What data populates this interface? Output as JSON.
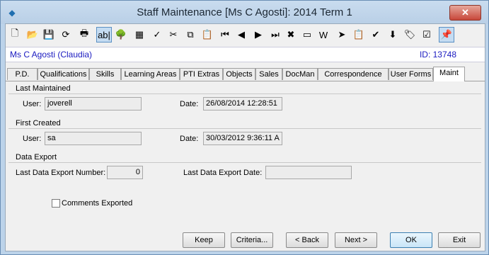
{
  "window": {
    "title": "Staff Maintenance  [Ms C Agosti]:  2014 Term 1",
    "close_label": "✕"
  },
  "toolbar": {
    "icons": [
      {
        "name": "new-icon",
        "glyph": "🗋"
      },
      {
        "name": "open-icon",
        "glyph": "📂"
      },
      {
        "name": "save-icon",
        "glyph": "💾"
      },
      {
        "name": "refresh-icon",
        "glyph": "⟳"
      },
      {
        "name": "print-icon",
        "glyph": "🖶"
      },
      {
        "name": "field-icon",
        "glyph": "ab|"
      },
      {
        "name": "tree-icon",
        "glyph": "🌳"
      },
      {
        "name": "calculator-icon",
        "glyph": "▦"
      },
      {
        "name": "spellcheck-icon",
        "glyph": "✓"
      },
      {
        "name": "cut-icon",
        "glyph": "✂"
      },
      {
        "name": "copy-icon",
        "glyph": "⧉"
      },
      {
        "name": "paste-icon",
        "glyph": "📋"
      },
      {
        "name": "first-record-icon",
        "glyph": "⏮"
      },
      {
        "name": "previous-record-icon",
        "glyph": "◀"
      },
      {
        "name": "next-record-icon",
        "glyph": "▶"
      },
      {
        "name": "last-record-icon",
        "glyph": "⏭"
      },
      {
        "name": "delete-icon",
        "glyph": "✖"
      },
      {
        "name": "card-icon",
        "glyph": "▭"
      },
      {
        "name": "word-icon",
        "glyph": "W"
      },
      {
        "name": "send-icon",
        "glyph": "➤"
      },
      {
        "name": "clipboard-icon",
        "glyph": "📋"
      },
      {
        "name": "approve-icon",
        "glyph": "✔"
      },
      {
        "name": "download-icon",
        "glyph": "⬇"
      },
      {
        "name": "tag-icon",
        "glyph": "🏷"
      },
      {
        "name": "checklist-icon",
        "glyph": "☑"
      },
      {
        "name": "pin-icon",
        "glyph": "📌"
      }
    ]
  },
  "banner": {
    "name": "Ms C Agosti (Claudia)",
    "id": "ID: 13748"
  },
  "tabs": [
    {
      "label": "P.D."
    },
    {
      "label": "Qualifications"
    },
    {
      "label": "Skills"
    },
    {
      "label": "Learning Areas"
    },
    {
      "label": "PTI Extras"
    },
    {
      "label": "Objects"
    },
    {
      "label": "Sales"
    },
    {
      "label": "DocMan"
    },
    {
      "label": "Correspondence"
    },
    {
      "label": "User Forms"
    },
    {
      "label": "Maint",
      "active": true
    }
  ],
  "maint": {
    "last_maintained": {
      "title": "Last Maintained",
      "user_label": "User:",
      "user_value": "joverell",
      "date_label": "Date:",
      "date_value": "26/08/2014 12:28:51"
    },
    "first_created": {
      "title": "First Created",
      "user_label": "User:",
      "user_value": "sa",
      "date_label": "Date:",
      "date_value": "30/03/2012 9:36:11 A"
    },
    "data_export": {
      "title": "Data Export",
      "number_label": "Last Data Export Number:",
      "number_value": "0",
      "date_label": "Last Data Export Date:",
      "date_value": ""
    },
    "comments_exported_label": "Comments Exported",
    "comments_exported_checked": false
  },
  "buttons": {
    "keep": "Keep",
    "criteria": "Criteria...",
    "back": "< Back",
    "next": "Next >",
    "ok": "OK",
    "exit": "Exit"
  }
}
